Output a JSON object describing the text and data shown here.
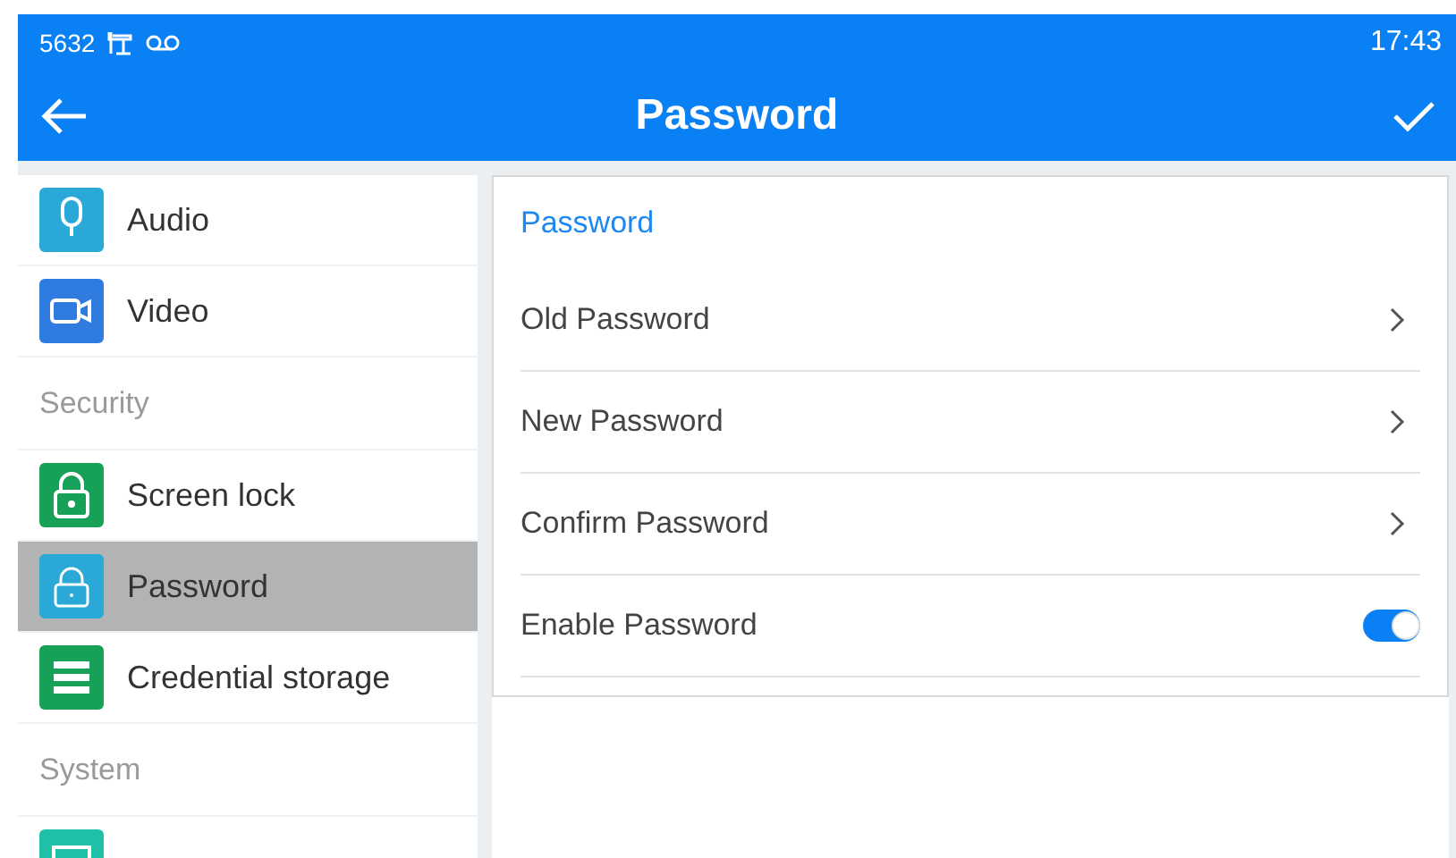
{
  "status_bar": {
    "extension": "5632",
    "time": "17:43"
  },
  "toolbar": {
    "title": "Password"
  },
  "sidebar": {
    "items": [
      {
        "kind": "item",
        "label": "Audio",
        "color": "#2aa9d8",
        "selected": false
      },
      {
        "kind": "item",
        "label": "Video",
        "color": "#2f7be0",
        "selected": false
      },
      {
        "kind": "header",
        "label": "Security"
      },
      {
        "kind": "item",
        "label": "Screen lock",
        "color": "#16a058",
        "selected": false
      },
      {
        "kind": "item",
        "label": "Password",
        "color": "#2aa9d8",
        "selected": true
      },
      {
        "kind": "item",
        "label": "Credential storage",
        "color": "#16a058",
        "selected": false
      },
      {
        "kind": "header",
        "label": "System"
      },
      {
        "kind": "item",
        "color": "#1fbfa8",
        "selected": false
      }
    ]
  },
  "panel": {
    "title": "Password",
    "rows": [
      {
        "kind": "link",
        "label": "Old Password"
      },
      {
        "kind": "link",
        "label": "New Password"
      },
      {
        "kind": "link",
        "label": "Confirm Password"
      },
      {
        "kind": "toggle",
        "label": "Enable Password",
        "on": true
      }
    ]
  }
}
